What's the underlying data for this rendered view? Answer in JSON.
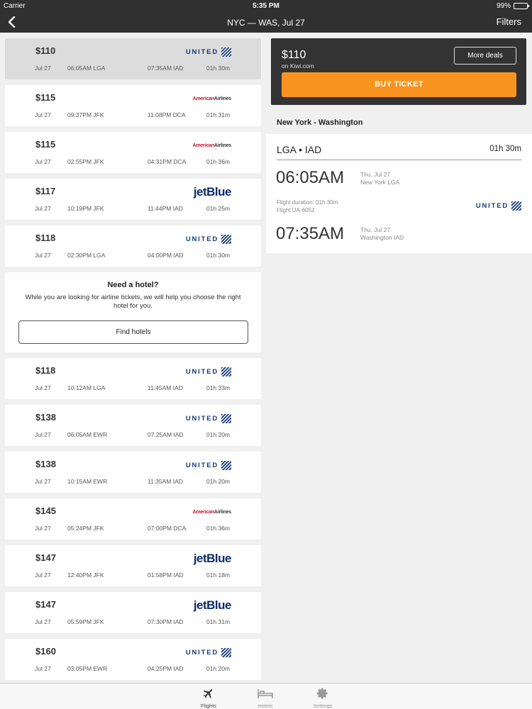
{
  "status_bar": {
    "carrier": "Carrier",
    "time": "5:35 PM",
    "battery": "99%",
    "battery_level": 0.99
  },
  "nav": {
    "title": "NYC — WAS, Jul 27",
    "filters": "Filters"
  },
  "flights": [
    {
      "price": "$110",
      "date": "Jul 27",
      "dep": "06:05AM LGA",
      "arr": "07:35AM IAD",
      "duration": "01h 30m",
      "airline": "united",
      "selected": true
    },
    {
      "price": "$115",
      "date": "Jul 27",
      "dep": "09:37PM JFK",
      "arr": "11:08PM DCA",
      "duration": "01h 31m",
      "airline": "american"
    },
    {
      "price": "$115",
      "date": "Jul 27",
      "dep": "02:55PM JFK",
      "arr": "04:31PM DCA",
      "duration": "01h 36m",
      "airline": "american"
    },
    {
      "price": "$117",
      "date": "Jul 27",
      "dep": "10:19PM JFK",
      "arr": "11:44PM IAD",
      "duration": "01h 25m",
      "airline": "jetblue"
    },
    {
      "price": "$118",
      "date": "Jul 27",
      "dep": "02:30PM LGA",
      "arr": "04:00PM IAD",
      "duration": "01h 30m",
      "airline": "united"
    },
    {
      "price": "$118",
      "date": "Jul 27",
      "dep": "10:12AM LGA",
      "arr": "11:45AM IAD",
      "duration": "01h 33m",
      "airline": "united"
    },
    {
      "price": "$138",
      "date": "Jul 27",
      "dep": "06:05AM EWR",
      "arr": "07:25AM IAD",
      "duration": "01h 20m",
      "airline": "united"
    },
    {
      "price": "$138",
      "date": "Jul 27",
      "dep": "10:15AM EWR",
      "arr": "11:35AM IAD",
      "duration": "01h 20m",
      "airline": "united"
    },
    {
      "price": "$145",
      "date": "Jul 27",
      "dep": "05:24PM JFK",
      "arr": "07:00PM DCA",
      "duration": "01h 36m",
      "airline": "american"
    },
    {
      "price": "$147",
      "date": "Jul 27",
      "dep": "12:40PM JFK",
      "arr": "01:58PM IAD",
      "duration": "01h 18m",
      "airline": "jetblue"
    },
    {
      "price": "$147",
      "date": "Jul 27",
      "dep": "05:59PM JFK",
      "arr": "07:30PM IAD",
      "duration": "01h 31m",
      "airline": "jetblue"
    },
    {
      "price": "$160",
      "date": "Jul 27",
      "dep": "03:05PM EWR",
      "arr": "04:25PM IAD",
      "duration": "01h 20m",
      "airline": "united"
    }
  ],
  "airline_logos": {
    "united": "UNITED",
    "american_1": "American",
    "american_2": "Airlines",
    "jetblue": "jetBlue"
  },
  "hotel_promo": {
    "title": "Need a hotel?",
    "text": "While you are looking for airline tickets, we will help you choose the right hotel for you.",
    "button": "Find hotels"
  },
  "offer": {
    "price": "$110",
    "source": "on Kiwi.com",
    "more_deals": "More deals",
    "buy": "BUY TICKET"
  },
  "detail": {
    "route_heading": "New York - Washington",
    "codes": "LGA • IAD",
    "total_duration": "01h 30m",
    "dep_time": "06:05AM",
    "dep_date": "Thu, Jul 27",
    "dep_place": "New York LGA",
    "flight_duration": "Flight duration: 01h 30m",
    "flight_number": "Flight UA-6052",
    "airline": "UNITED",
    "arr_time": "07:35AM",
    "arr_date": "Thu, Jul 27",
    "arr_place": "Washington IAD"
  },
  "tabs": [
    {
      "label": "Flights",
      "icon": "airplane-icon",
      "active": true
    },
    {
      "label": "Hotels",
      "icon": "bed-icon",
      "active": false
    },
    {
      "label": "Settings",
      "icon": "gear-icon",
      "active": false
    }
  ]
}
